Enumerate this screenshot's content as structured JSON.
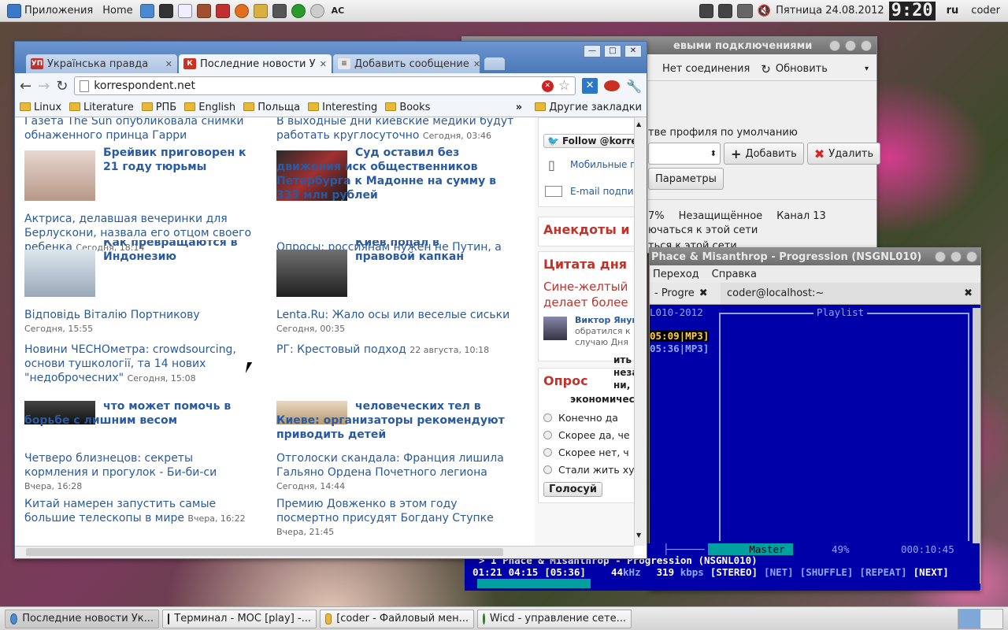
{
  "top_panel": {
    "apps_menu": "Приложения",
    "home": "Home",
    "launcher_icons": [
      "browser-icon",
      "terminal-icon",
      "text-editor-icon",
      "library-icon",
      "media-icon",
      "firefox-icon",
      "paint-icon",
      "video-icon",
      "wicd-icon",
      "disc-icon",
      "ac-icon"
    ],
    "ac_label": "AC",
    "datetime": "Пятница 24.08.2012",
    "clock": "9:20",
    "lang": "ru",
    "user": "coder"
  },
  "wicd": {
    "title_fragment": "евыми подключениями",
    "no_connection": "Нет соединения",
    "refresh": "Обновить",
    "default_profile": "тве профиля по умолчанию",
    "add": "Добавить",
    "remove": "Удалить",
    "params": "Параметры",
    "signal": "7%",
    "security": "Незащищённое",
    "channel": "Канал 13",
    "connect1": "ючаться к этой сети",
    "connect2": "ться к этой сети"
  },
  "terminal": {
    "title": "Phace & Misanthrop - Progression (NSGNL010)",
    "menu": [
      "Переход",
      "Справка"
    ],
    "tab1": "- Progre",
    "tab2": "coder@localhost:~",
    "album_fragment": "L010-2012",
    "playlist_label": "Playlist",
    "track1_time": "05:09",
    "track1_fmt": "MP3",
    "track2_time": "05:36",
    "track2_fmt": "MP3",
    "mixer_label": "Master",
    "volume": "49%",
    "total_time": "000:10:45",
    "now_playing": "> 1 Phace & Misanthrop - Progression (NSGNL010)",
    "pos": "01:21",
    "left": "04:15",
    "len": "[05:36]",
    "khz": "44",
    "khz_unit": "kHz",
    "kbps": "319",
    "kbps_unit": "kbps",
    "stereo": "[STEREO]",
    "net": "[NET]",
    "shuffle": "[SHUFFLE]",
    "repeat": "[REPEAT]",
    "next": "[NEXT]",
    "progress": 0.27
  },
  "chrome": {
    "tabs": [
      {
        "label": "Українська правда",
        "fav": "УП"
      },
      {
        "label": "Последние новости У",
        "fav": "К"
      },
      {
        "label": "Добавить сообщение",
        "fav": "≡"
      }
    ],
    "url": "korrespondent.net",
    "bookmarks": [
      "Linux",
      "Literature",
      "РПБ",
      "English",
      "Польща",
      "Interesting",
      "Books"
    ],
    "other_bookmarks": "Другие закладки",
    "more": "»"
  },
  "page": {
    "top_left": "Газета The Sun опубликовала снимки обнаженного принца Гарри",
    "top_right": "В выходные дни киевские медики будут работать круглосуточно",
    "top_right_date": "Сегодня, 03:46",
    "h_breivik": "Брейвик приговорен к 21 году тюрьмы",
    "h_madonna": "Суд оставил без движения иск общественников Петербурга к Мадонне на сумму в 333 млн рублей",
    "actress": "Актриса, делавшая вечеринки для Берлускони, назвала его отцом своего ребенка",
    "actress_date": "Сегодня, 18:14",
    "polls_ru": "Опросы: россиянам нужен не Путин, а",
    "h_indonesia_frag": "Как превращаются в",
    "h_indonesia": "Индонезию",
    "h_kyiv_frag": "Киев попал в",
    "h_kyiv": "правовой капкан",
    "portnikov": "Відповідь Віталію Портникову",
    "portnikov_date": "Сегодня, 15:55",
    "lenta": "Lenta.Ru: Жало осы или веселые сиськи",
    "lenta_date": "Сегодня, 00:35",
    "chesno": "Новини ЧЕСНОметра: crowdsourcing, основи тушкології, та 14 нових \"недоброчесних\"",
    "chesno_date": "Сегодня, 15:08",
    "rg": "РГ: Крестовый подход",
    "rg_date": "22 августа, 10:18",
    "h_weight": "что может помочь в борьбе с лишним весом",
    "h_bodies": "человеческих тел в Киеве: организаторы рекомендуют приводить детей",
    "quads": "Четверо близнецов: секреты кормления и прогулок - Би-би-си",
    "quads_date": "Вчера, 16:28",
    "france": "Отголоски скандала: Франция лишила Гальяно Ордена Почетного легиона",
    "france_date": "Сегодня, 14:44",
    "china": "Китай намерен запустить самые большие телескопы в мире",
    "china_date": "Вчера, 16:22",
    "stupka": "Премию Довженко в этом году посмертно присудят Богдану Ступке",
    "stupka_date": "Вчера, 21:45",
    "sb_follow": "Follow @korres",
    "sb_mobile": "Мобильные п",
    "sb_email": "E-mail подпи",
    "sb_jokes": "Анекдоты и",
    "sb_quote_title": "Цитата дня",
    "sb_quote": "Сине-желтый делает более",
    "sb_author": "Виктор Януко",
    "sb_author_text": "обратился к случаю Дня",
    "sb_overlay1": "ить ж",
    "sb_overlay2": "незав",
    "sb_overlay3": "ни, по",
    "sb_overlay4": "экономическом",
    "poll_title": "Опрос",
    "poll_options": [
      "Конечно да",
      "Скорее да, че",
      "Скорее нет, ч",
      "Стали жить ху"
    ],
    "vote": "Голосуй"
  },
  "taskbar": [
    {
      "label": "Последние новости Ук...",
      "icon": "chrome-icon"
    },
    {
      "label": "Терминал - MOC [play] -...",
      "icon": "terminal-icon"
    },
    {
      "label": "[coder - Файловый мен...",
      "icon": "file-manager-icon"
    },
    {
      "label": "Wicd - управление сете...",
      "icon": "wicd-icon"
    }
  ]
}
